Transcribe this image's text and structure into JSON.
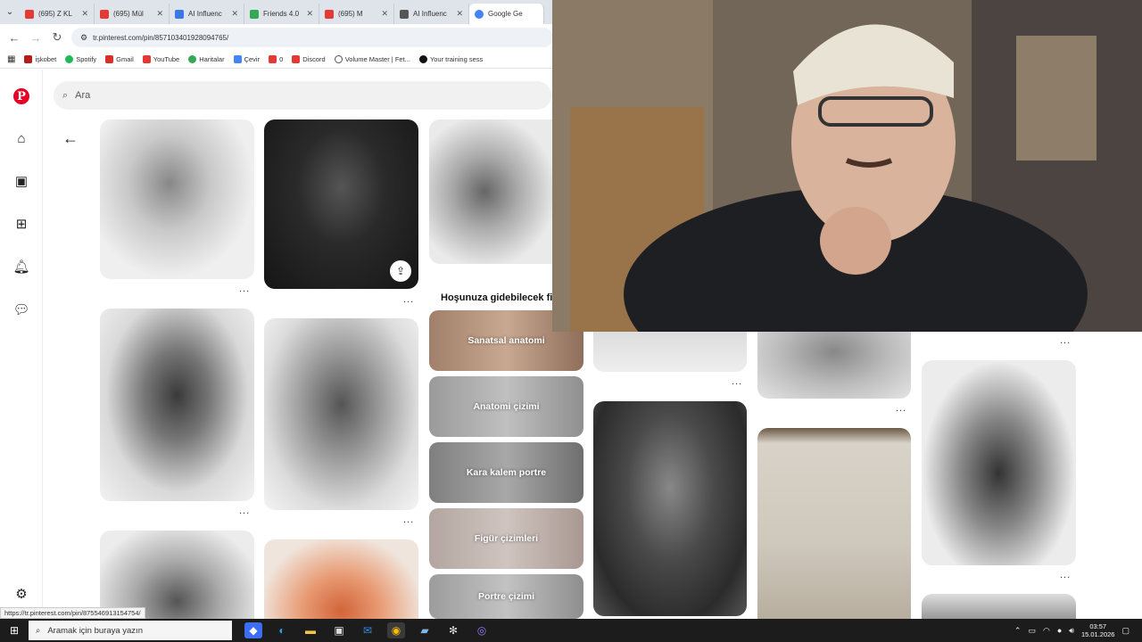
{
  "browser": {
    "tabs": [
      {
        "label": "(695) Z KL",
        "color": "#e53935"
      },
      {
        "label": "(695) Mül",
        "color": "#e53935"
      },
      {
        "label": "AI Influenc",
        "color": "#3b78e7"
      },
      {
        "label": "Friends 4.0",
        "color": "#34a853"
      },
      {
        "label": "(695) M",
        "color": "#e53935"
      },
      {
        "label": "AI Influenc",
        "color": "#555555"
      },
      {
        "label": "Google Ge",
        "color": "#4285f4"
      }
    ],
    "url": "tr.pinterest.com/pin/857103401928094765/",
    "bookmarks": [
      {
        "label": "i̇şkobet",
        "color": "#b71c1c"
      },
      {
        "label": "Spotify",
        "color": "#1db954"
      },
      {
        "label": "Gmail",
        "color": "#d93025"
      },
      {
        "label": "YouTube",
        "color": "#e53935"
      },
      {
        "label": "Haritalar",
        "color": "#34a853"
      },
      {
        "label": "Çevir",
        "color": "#4285f4"
      },
      {
        "label": "0",
        "color": "#e53935"
      },
      {
        "label": "Discord",
        "color": "#e53935"
      },
      {
        "label": "Volume Master | Fet...",
        "color": "#555555"
      },
      {
        "label": "Your training sess",
        "color": "#111111"
      }
    ]
  },
  "search": {
    "placeholder": "Ara"
  },
  "section": {
    "title": "Hoşunuza gidebilecek fik"
  },
  "ideas": [
    {
      "label": "Sanatsal anatomi"
    },
    {
      "label": "Anatomi çizimi"
    },
    {
      "label": "Kara kalem portre"
    },
    {
      "label": "Figür çizimleri"
    },
    {
      "label": "Portre çizimi"
    }
  ],
  "more_label": "...",
  "status_url": "https://tr.pinterest.com/pin/875546913154754/",
  "taskbar": {
    "search_placeholder": "Aramak için buraya yazın",
    "time": "03:57",
    "date": "15.01.2026"
  },
  "colors": {
    "pinterest_red": "#e60023",
    "taskbar": "#1c1c1c"
  }
}
